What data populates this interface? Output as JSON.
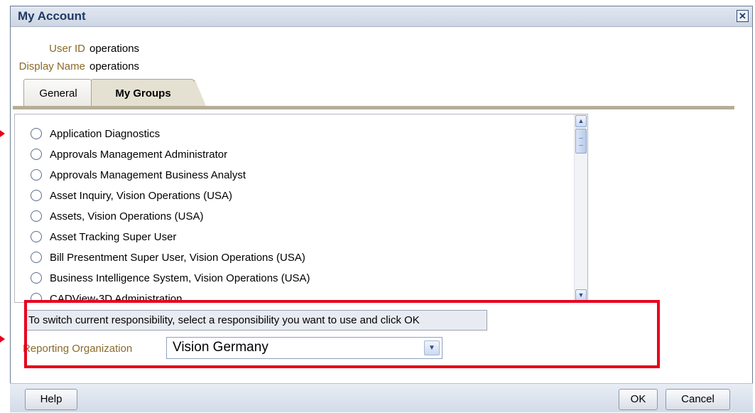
{
  "dialog": {
    "title": "My Account",
    "close_icon_glyph": "✕"
  },
  "user": {
    "user_id_label": "User ID",
    "user_id_value": "operations",
    "display_name_label": "Display Name",
    "display_name_value": "operations"
  },
  "tabs": [
    {
      "label": "General",
      "selected": false
    },
    {
      "label": "My Groups",
      "selected": true
    }
  ],
  "groups": {
    "items": [
      "Application Diagnostics",
      "Approvals Management Administrator",
      "Approvals Management Business Analyst",
      "Asset Inquiry, Vision Operations (USA)",
      "Assets, Vision Operations (USA)",
      "Asset Tracking Super User",
      "Bill Presentment Super User, Vision Operations (USA)",
      "Business Intelligence System, Vision Operations (USA)",
      "CADView-3D Administration"
    ]
  },
  "hint_text": "To switch current responsibility, select a responsibility you want to use and click OK",
  "reporting": {
    "label": "Reporting Organization",
    "selected_value": "Vision Germany"
  },
  "footer": {
    "help_label": "Help",
    "ok_label": "OK",
    "cancel_label": "Cancel"
  },
  "colors": {
    "highlight": "#e8001c",
    "title_text": "#1f3a66",
    "label_text": "#8a6a2a",
    "tab_active": "#e5e1d2"
  }
}
